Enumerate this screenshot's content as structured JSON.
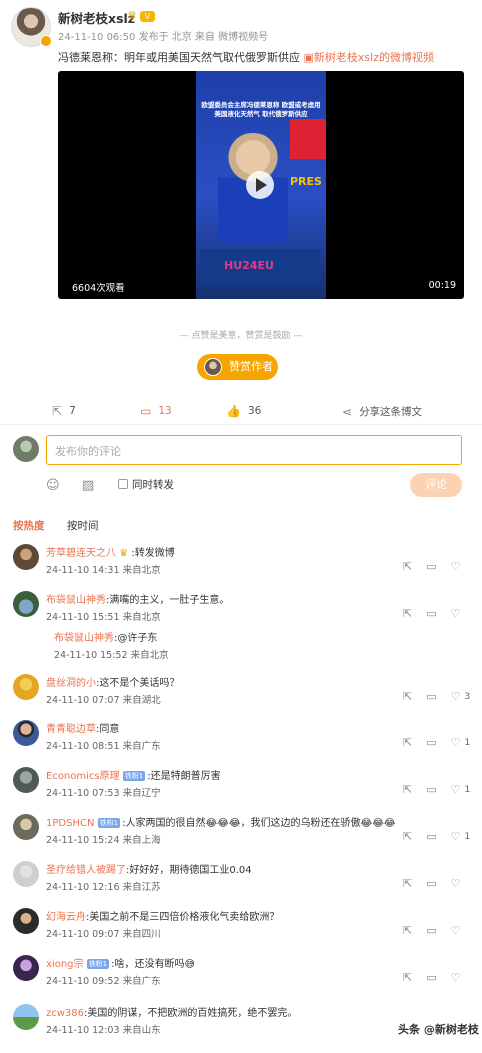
{
  "post": {
    "author": "新树老枝xslz",
    "meta": "24-11-10 06:50  发布于 北京  来自 微博视频号",
    "text": "冯德莱恩称：明年或用美国天然气取代俄罗斯供应 ",
    "link_text": "新树老枝xslz的微博视频",
    "video": {
      "caption": "欧盟委员会主席冯德莱恩称 欧盟或考虑用美国液化天然气 取代俄罗斯供应",
      "views": "6604次观看",
      "duration": "00:19",
      "brand_text": "PRES",
      "event_text": "HU24EU"
    },
    "reward_line": "点赞是美意，赞赏是鼓励",
    "reward_button": "赞赏作者",
    "actions": {
      "repost": "7",
      "comment": "13",
      "like": "36",
      "share": "分享这条博文"
    }
  },
  "compose": {
    "placeholder": "发布你的评论",
    "repost_label": "同时转发",
    "submit_label": "评论"
  },
  "tabs": {
    "hot": "按热度",
    "time": "按时间"
  },
  "comments": [
    {
      "name": "芳草碧连天之八",
      "text": ":转发微博",
      "time": "24-11-10 14:31",
      "loc": "来自北京",
      "likes": ""
    },
    {
      "name": "布袋鼠山神秀",
      "text": ":满嘴的主义，一肚子生意。",
      "time": "24-11-10 15:51",
      "loc": "来自北京",
      "likes": "",
      "reply": {
        "name": "布袋鼠山神秀",
        "text": ":@许子东",
        "time": "24-11-10 15:52",
        "loc": "来自北京"
      }
    },
    {
      "name": "盘丝洞的小",
      "text": ":这不是个美话吗？",
      "time": "24-11-10 07:07",
      "loc": "来自湖北",
      "likes": "3"
    },
    {
      "name": "青青聪边草",
      "text": ":同意",
      "time": "24-11-10 08:51",
      "loc": "来自广东",
      "likes": "1"
    },
    {
      "name": "Economics原理",
      "text": ":还是特朗普厉害",
      "time": "24-11-10 07:53",
      "loc": "来自辽宁",
      "likes": "1",
      "fan": "铁粉1"
    },
    {
      "name": "1PDSHCN",
      "text": ":人家两国的很自然😂😂😂，我们这边的乌粉还在骄傲😂😂😂",
      "time": "24-11-10 15:24",
      "loc": "来自上海",
      "likes": "1",
      "fan": "铁粉1"
    },
    {
      "name": "圣疗给错人被踢了",
      "text": ":好好好，期待德国工业0.04",
      "time": "24-11-10 12:16",
      "loc": "来自江苏",
      "likes": ""
    },
    {
      "name": "幻海云舟",
      "text": ":美国之前不是三四倍价格液化气卖给欧洲？",
      "time": "24-11-10 09:07",
      "loc": "来自四川",
      "likes": ""
    },
    {
      "name": "xiong宗",
      "text": ":啥，还没有断吗😅",
      "time": "24-11-10 09:52",
      "loc": "来自广东",
      "likes": "",
      "fan": "铁粉1"
    },
    {
      "name": "zcw386",
      "text": ":美国的阴谋，不把欧洲的百姓搞死，绝不罢完。",
      "time": "24-11-10 12:03",
      "loc": "来自山东",
      "likes": ""
    }
  ],
  "watermark": "头条 @新树老枝",
  "colors": {
    "accent": "#eb7350",
    "gold": "#f7a300",
    "fan_badge": "#77a7ea"
  }
}
